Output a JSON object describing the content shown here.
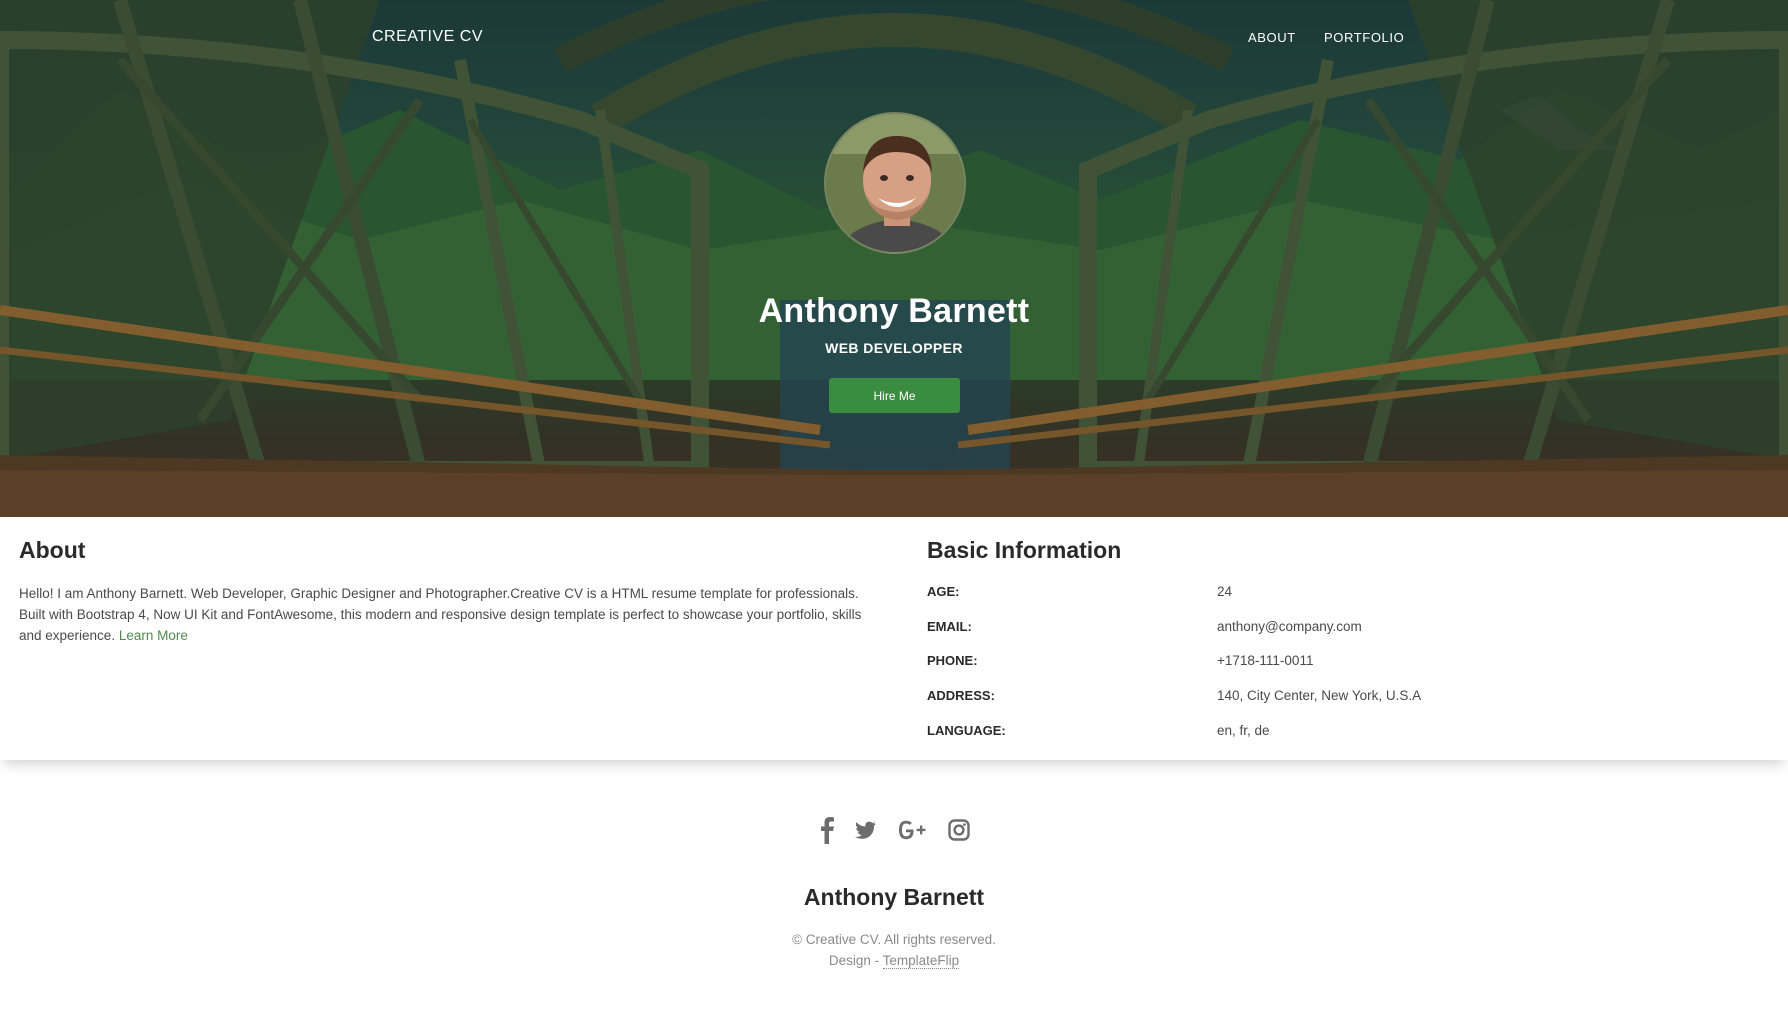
{
  "nav": {
    "brand": "CREATIVE CV",
    "links": [
      {
        "label": "ABOUT"
      },
      {
        "label": "PORTFOLIO"
      }
    ]
  },
  "hero": {
    "name": "Anthony Barnett",
    "title": "WEB DEVELOPPER",
    "button_label": "Hire Me"
  },
  "about": {
    "heading": "About",
    "text": "Hello! I am Anthony Barnett. Web Developer, Graphic Designer and Photographer.Creative CV is a HTML resume template for professionals. Built with Bootstrap 4, Now UI Kit and FontAwesome, this modern and responsive design template is perfect to showcase your portfolio, skills and experience.",
    "link_label": "Learn More"
  },
  "basic_info": {
    "heading": "Basic Information",
    "rows": [
      {
        "label": "AGE:",
        "value": "24"
      },
      {
        "label": "EMAIL:",
        "value": "anthony@company.com"
      },
      {
        "label": "PHONE:",
        "value": "+1718-111-0011"
      },
      {
        "label": "ADDRESS:",
        "value": "140, City Center, New York, U.S.A"
      },
      {
        "label": "LANGUAGE:",
        "value": "en, fr, de"
      }
    ]
  },
  "footer": {
    "social_icons": [
      "facebook-icon",
      "twitter-icon",
      "google-plus-icon",
      "instagram-icon"
    ],
    "name": "Anthony Barnett",
    "copyright": "© Creative CV. All rights reserved.",
    "design_prefix": "Design - ",
    "design_link": "TemplateFlip"
  },
  "colors": {
    "accent_green": "#3a8d3e",
    "link_green": "#4f8a4f",
    "text_dark": "#2a2a2a",
    "footer_gray": "#8a8a8a"
  }
}
